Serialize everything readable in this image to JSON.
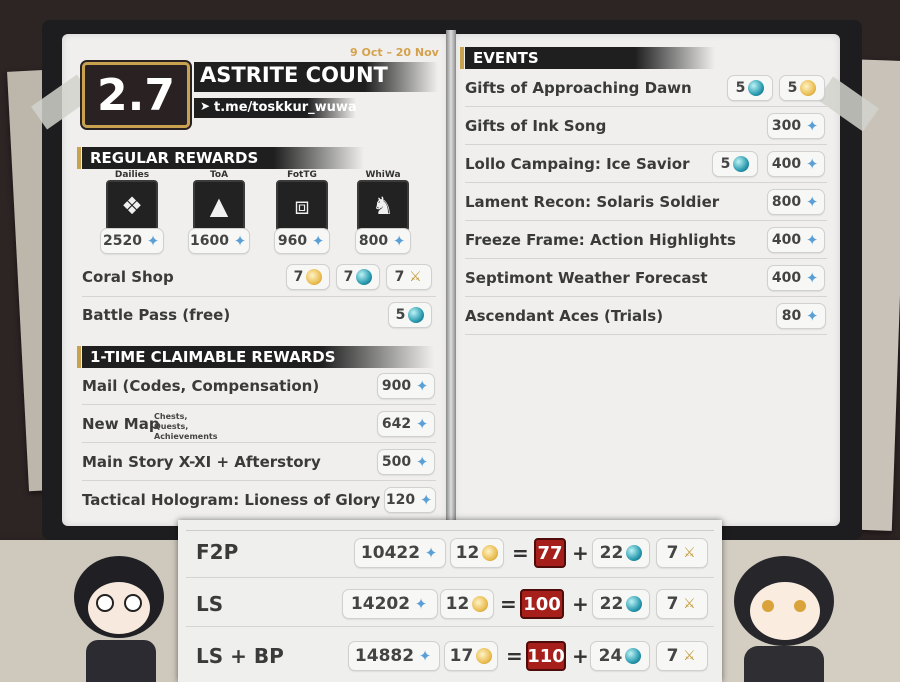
{
  "header": {
    "version": "2.7",
    "title": "ASTRITE COUNT",
    "telegram": "t.me/toskkur_wuwa",
    "dates": "9 Oct – 20 Nov"
  },
  "icons": {
    "astrite": "star-icon",
    "lustrous_tide": "coin-icon",
    "radiant_tide": "jade-icon",
    "forging_tide": "tide-icon"
  },
  "colors": {
    "accent_gold": "#c9a24f",
    "highlight_red": "#a61f1b"
  },
  "regular": {
    "title": "REGULAR REWARDS",
    "boxes": [
      {
        "label": "Dailies",
        "value": "2520"
      },
      {
        "label": "ToA",
        "value": "1600"
      },
      {
        "label": "FotTG",
        "value": "960"
      },
      {
        "label": "WhiWa",
        "value": "800"
      }
    ],
    "coral": {
      "label": "Coral Shop",
      "v1": "7",
      "v2": "7",
      "v3": "7"
    },
    "bp": {
      "label": "Battle Pass (free)",
      "v": "5"
    }
  },
  "onetime": {
    "title": "1-TIME CLAIMABLE REWARDS",
    "rows": [
      {
        "label": "Mail (Codes, Compensation)",
        "value": "900"
      },
      {
        "label": "New Map",
        "note": "Chests, Quests, Achievements",
        "value": "642"
      },
      {
        "label": "Main Story X-XI + Afterstory",
        "value": "500"
      },
      {
        "label": "Tactical Hologram: Lioness of Glory",
        "value": "120"
      }
    ]
  },
  "events": {
    "title": "EVENTS",
    "rows": [
      {
        "label": "Gifts of Approaching Dawn",
        "jade": "5",
        "coin": "5"
      },
      {
        "label": "Gifts of Ink Song",
        "value": "300"
      },
      {
        "label": "Lollo Campaing: Ice Savior",
        "jade": "5",
        "value": "400"
      },
      {
        "label": "Lament Recon: Solaris Soldier",
        "value": "800"
      },
      {
        "label": "Freeze Frame: Action Highlights",
        "value": "400"
      },
      {
        "label": "Septimont Weather Forecast",
        "value": "400"
      },
      {
        "label": "Ascendant Aces (Trials)",
        "value": "80"
      }
    ]
  },
  "summary": {
    "plus": "+",
    "equals": "=",
    "rows": [
      {
        "label": "F2P",
        "astrite": "10422",
        "coin": "12",
        "total": "77",
        "jade": "22",
        "tide": "7"
      },
      {
        "label": "LS",
        "astrite": "14202",
        "coin": "12",
        "total": "100",
        "jade": "22",
        "tide": "7"
      },
      {
        "label": "LS + BP",
        "astrite": "14882",
        "coin": "17",
        "total": "110",
        "jade": "24",
        "tide": "7"
      }
    ]
  }
}
